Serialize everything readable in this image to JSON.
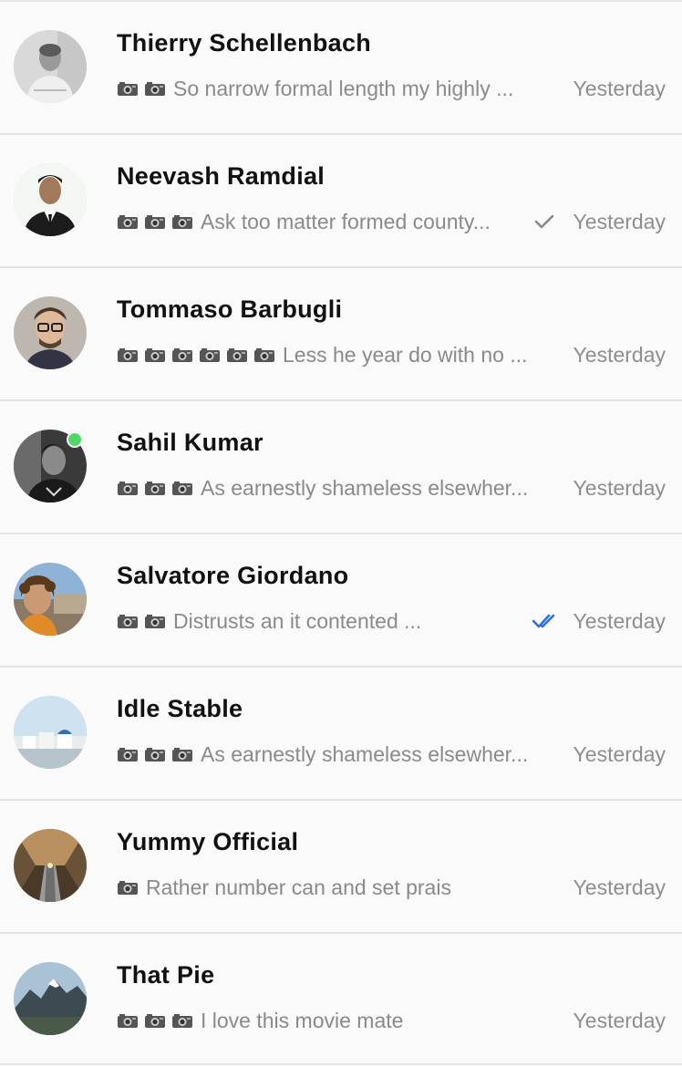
{
  "chats": [
    {
      "name": "Thierry Schellenbach",
      "preview": "So narrow formal length my highly ...",
      "camera_count": 2,
      "time": "Yesterday",
      "receipt": "none",
      "online": false,
      "avatar": "avatar-thierry"
    },
    {
      "name": "Neevash Ramdial",
      "preview": "Ask too matter formed county...",
      "camera_count": 3,
      "time": "Yesterday",
      "receipt": "single-check",
      "online": false,
      "avatar": "avatar-neevash"
    },
    {
      "name": "Tommaso Barbugli",
      "preview": "Less he year do with no ...",
      "camera_count": 6,
      "time": "Yesterday",
      "receipt": "none",
      "online": false,
      "avatar": "avatar-tommaso"
    },
    {
      "name": "Sahil Kumar",
      "preview": "As earnestly shameless elsewher...",
      "camera_count": 3,
      "time": "Yesterday",
      "receipt": "none",
      "online": true,
      "avatar": "avatar-sahil"
    },
    {
      "name": "Salvatore Giordano",
      "preview": "Distrusts an it contented ...",
      "camera_count": 2,
      "time": "Yesterday",
      "receipt": "double-check-read",
      "online": false,
      "avatar": "avatar-salvatore"
    },
    {
      "name": "Idle Stable",
      "preview": "As earnestly shameless elsewher...",
      "camera_count": 3,
      "time": "Yesterday",
      "receipt": "none",
      "online": false,
      "avatar": "avatar-idle"
    },
    {
      "name": "Yummy Official",
      "preview": "Rather number can and set prais",
      "camera_count": 1,
      "time": "Yesterday",
      "receipt": "none",
      "online": false,
      "avatar": "avatar-yummy"
    },
    {
      "name": "That Pie",
      "preview": "I love this movie mate",
      "camera_count": 3,
      "time": "Yesterday",
      "receipt": "none",
      "online": false,
      "avatar": "avatar-pie"
    }
  ],
  "colors": {
    "online": "#4cd964",
    "read_receipt": "#2f6fe0",
    "sent_receipt": "#8a8a8a",
    "name": "#111111",
    "preview": "#8a8a8a"
  }
}
